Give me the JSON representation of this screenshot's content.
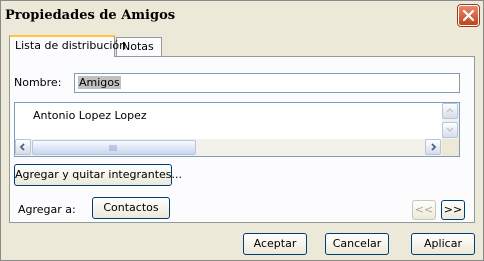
{
  "window": {
    "title": "Propiedades de Amigos"
  },
  "tabs": [
    {
      "label": "Lista de distribución"
    },
    {
      "label": "Notas"
    }
  ],
  "form": {
    "name_label": "Nombre:",
    "name_value": "Amigos",
    "members": [
      "Antonio Lopez Lopez"
    ],
    "add_remove_button": "Agregar y quitar integrantes...",
    "add_to_label": "Agregar a:",
    "contacts_button": "Contactos",
    "prev_button": "<<",
    "next_button": ">>"
  },
  "footer": {
    "accept": "Aceptar",
    "cancel": "Cancelar",
    "apply": "Aplicar"
  },
  "colors": {
    "window_bg": "#ece9d8",
    "close_red": "#c4431f",
    "tab_highlight": "#ffc73c",
    "button_border": "#003c74"
  }
}
